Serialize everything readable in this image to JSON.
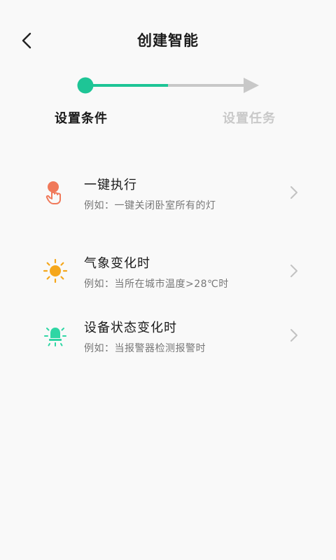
{
  "header": {
    "title": "创建智能",
    "back_icon": "chevron-left-icon"
  },
  "stepper": {
    "accent_color": "#1ec596",
    "inactive_color": "#c8c8c8",
    "steps": [
      {
        "label": "设置条件",
        "active": true
      },
      {
        "label": "设置任务",
        "active": false
      }
    ]
  },
  "conditions": [
    {
      "title": "一键执行",
      "description": "例如：一键关闭卧室所有的灯",
      "icon": "tap-hand-icon",
      "icon_color": "#f0795a"
    },
    {
      "title": "气象变化时",
      "description": "例如：当所在城市温度>28℃时",
      "icon": "sun-icon",
      "icon_color": "#f5a71c"
    },
    {
      "title": "设备状态变化时",
      "description": "例如：当报警器检测报警时",
      "icon": "alarm-bulb-icon",
      "icon_color": "#2fd6a4"
    }
  ]
}
